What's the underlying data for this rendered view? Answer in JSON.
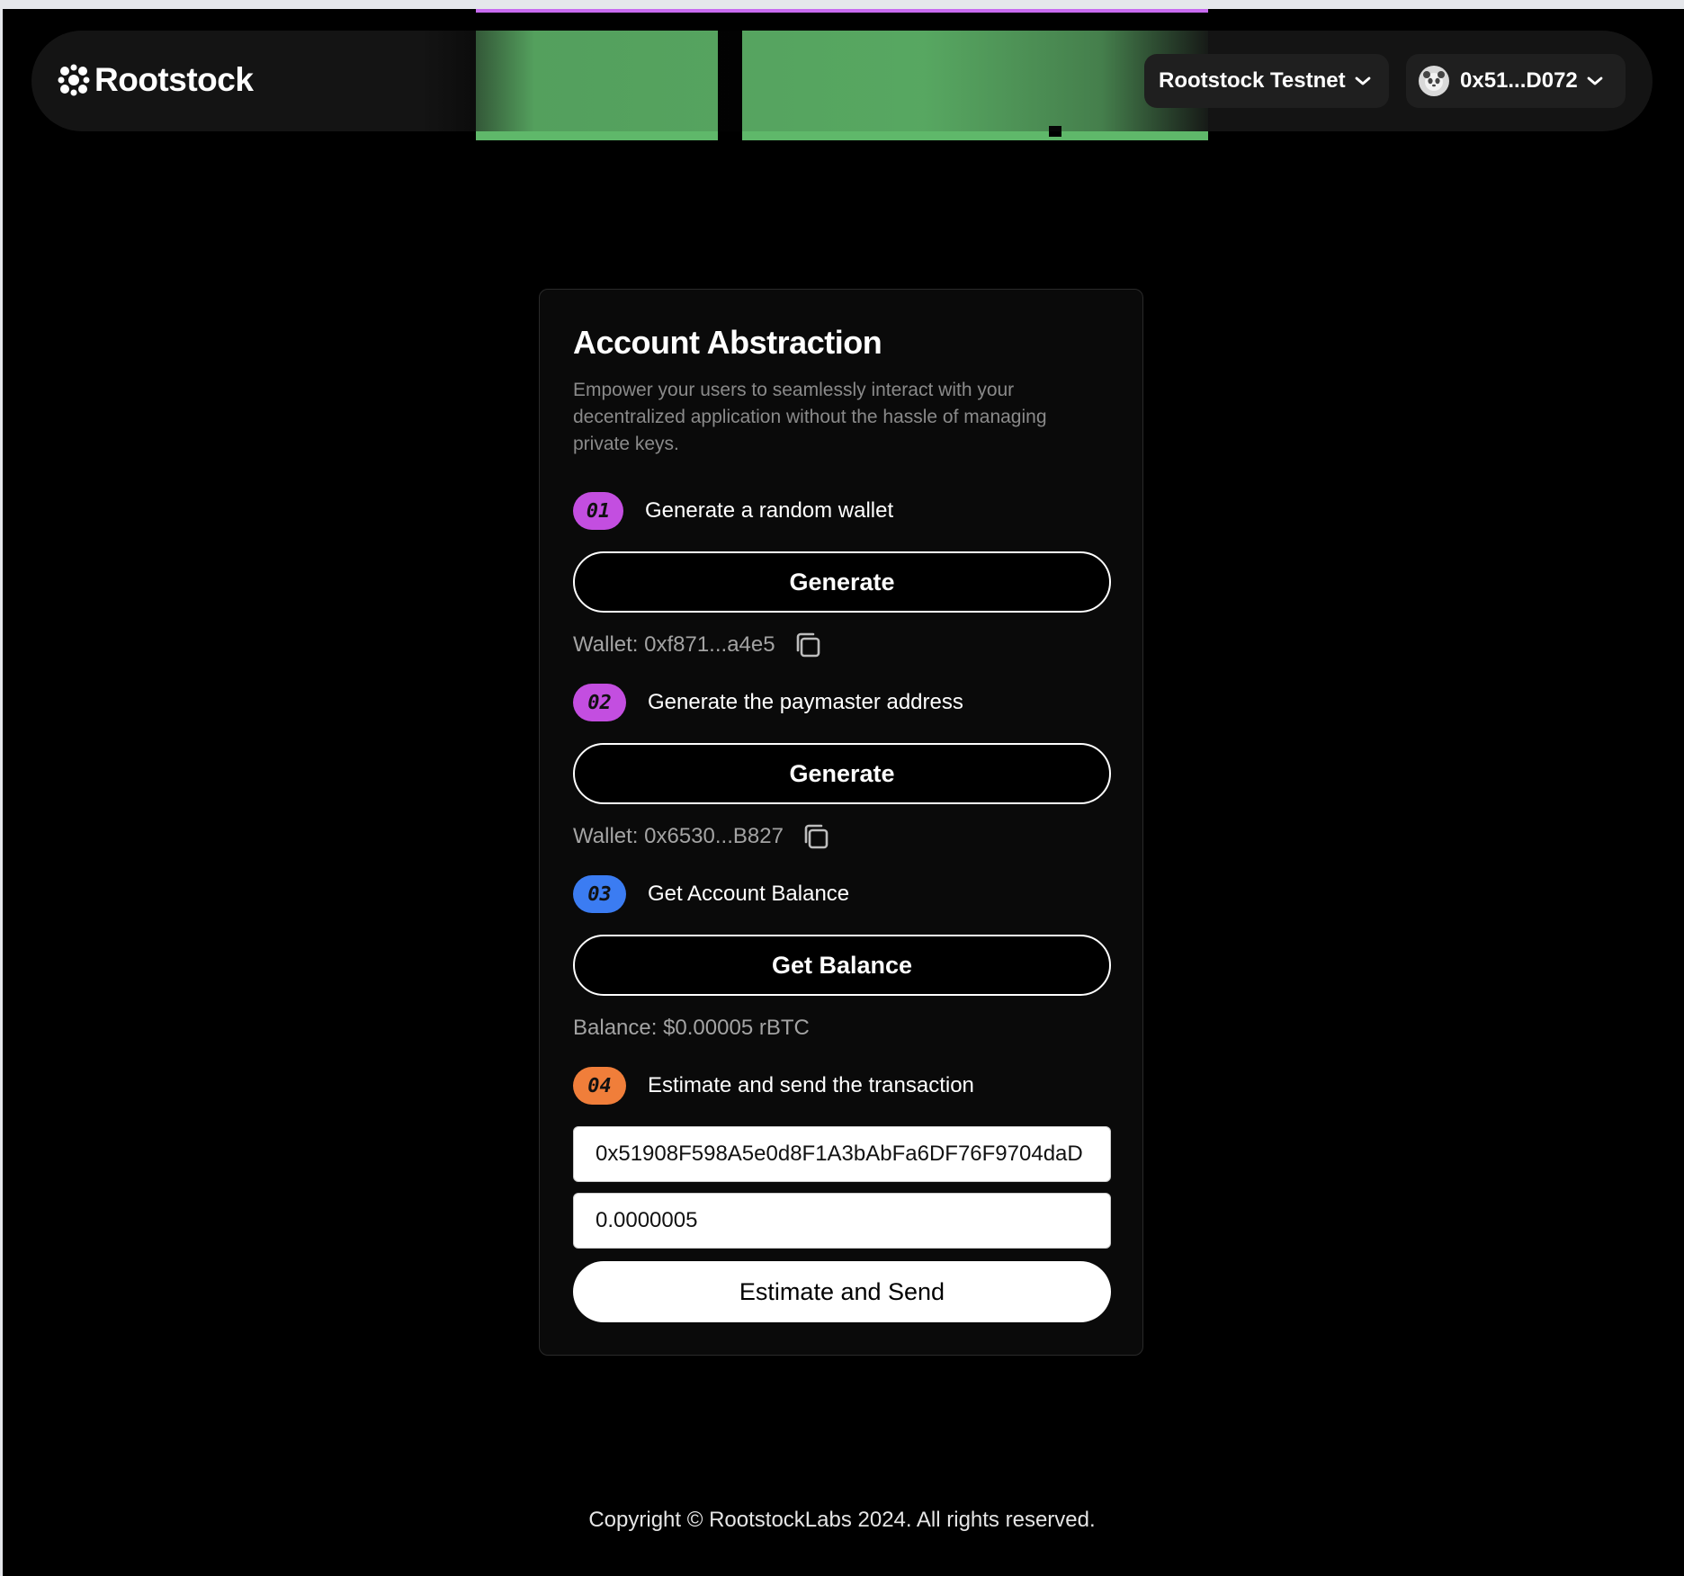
{
  "header": {
    "logo_text": "Rootstock",
    "network_label": "Rootstock Testnet",
    "account_label": "0x51...D072"
  },
  "card": {
    "title": "Account Abstraction",
    "description": "Empower your users to seamlessly interact with your decentralized application without the hassle of managing private keys.",
    "steps": [
      {
        "badge": "01",
        "badge_color": "#c34ee0",
        "label": "Generate a random wallet",
        "button": "Generate",
        "result": "Wallet: 0xf871...a4e5"
      },
      {
        "badge": "02",
        "badge_color": "#c34ee0",
        "label": "Generate the paymaster address",
        "button": "Generate",
        "result": "Wallet: 0x6530...B827"
      },
      {
        "badge": "03",
        "badge_color": "#3b7cf2",
        "label": "Get Account Balance",
        "button": "Get Balance",
        "result": "Balance: $0.00005 rBTC"
      },
      {
        "badge": "04",
        "badge_color": "#f07e3a",
        "label": "Estimate and send the transaction"
      }
    ],
    "address_input_value": "0x51908F598A5e0d8F1A3bAbFa6DF76F9704daD",
    "amount_input_value": "0.0000005",
    "send_button": "Estimate and Send"
  },
  "footer": {
    "copyright": "Copyright © RootstockLabs 2024. All rights reserved."
  },
  "icons": {
    "logo": "rootstock-logo-icon",
    "chevron": "chevron-down-icon",
    "copy": "copy-icon",
    "avatar": "panda-avatar-icon"
  }
}
